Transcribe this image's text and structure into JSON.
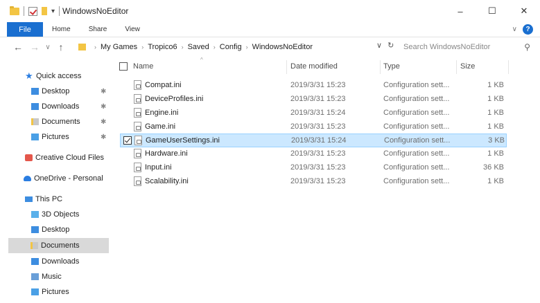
{
  "window": {
    "title": "WindowsNoEditor",
    "minimize": "–",
    "maximize": "☐",
    "close": "✕"
  },
  "ribbon": {
    "tabs": [
      "File",
      "Home",
      "Share",
      "View"
    ],
    "help": "?",
    "expand": "∨"
  },
  "address": {
    "back": "←",
    "forward": "→",
    "recent": "∨",
    "up": "↑",
    "crumbs": [
      "My Games",
      "Tropico6",
      "Saved",
      "Config",
      "WindowsNoEditor"
    ],
    "dropdown": "∨",
    "refresh": "↻",
    "search_placeholder": "Search WindowsNoEditor",
    "search_icon": "⚲"
  },
  "nav": {
    "quick_access": "Quick access",
    "quick_items": [
      {
        "label": "Desktop",
        "icon": "desktop-icon"
      },
      {
        "label": "Downloads",
        "icon": "downloads-icon"
      },
      {
        "label": "Documents",
        "icon": "documents-icon"
      },
      {
        "label": "Pictures",
        "icon": "pictures-icon"
      }
    ],
    "creative_cloud": "Creative Cloud Files",
    "onedrive": "OneDrive - Personal",
    "this_pc": "This PC",
    "pc_items": [
      {
        "label": "3D Objects",
        "icon": "3d-objects-icon"
      },
      {
        "label": "Desktop",
        "icon": "desktop-icon"
      },
      {
        "label": "Documents",
        "icon": "documents-icon",
        "selected": true
      },
      {
        "label": "Downloads",
        "icon": "downloads-icon"
      },
      {
        "label": "Music",
        "icon": "music-icon"
      },
      {
        "label": "Pictures",
        "icon": "pictures-icon"
      }
    ],
    "pin_glyph": "✱"
  },
  "columns": {
    "name": "Name",
    "date": "Date modified",
    "type": "Type",
    "size": "Size",
    "sort_caret": "^"
  },
  "files": [
    {
      "name": "Compat.ini",
      "date": "2019/3/31 15:23",
      "type": "Configuration sett...",
      "size": "1 KB"
    },
    {
      "name": "DeviceProfiles.ini",
      "date": "2019/3/31 15:23",
      "type": "Configuration sett...",
      "size": "1 KB"
    },
    {
      "name": "Engine.ini",
      "date": "2019/3/31 15:24",
      "type": "Configuration sett...",
      "size": "1 KB"
    },
    {
      "name": "Game.ini",
      "date": "2019/3/31 15:23",
      "type": "Configuration sett...",
      "size": "1 KB"
    },
    {
      "name": "GameUserSettings.ini",
      "date": "2019/3/31 15:24",
      "type": "Configuration sett...",
      "size": "3 KB",
      "selected": true
    },
    {
      "name": "Hardware.ini",
      "date": "2019/3/31 15:23",
      "type": "Configuration sett...",
      "size": "1 KB"
    },
    {
      "name": "Input.ini",
      "date": "2019/3/31 15:23",
      "type": "Configuration sett...",
      "size": "36 KB"
    },
    {
      "name": "Scalability.ini",
      "date": "2019/3/31 15:23",
      "type": "Configuration sett...",
      "size": "1 KB"
    }
  ],
  "colors": {
    "accent": "#1a6fd0",
    "selection_bg": "#cce8ff",
    "selection_border": "#99d1ff",
    "nav_selected": "#d9d9d9"
  }
}
